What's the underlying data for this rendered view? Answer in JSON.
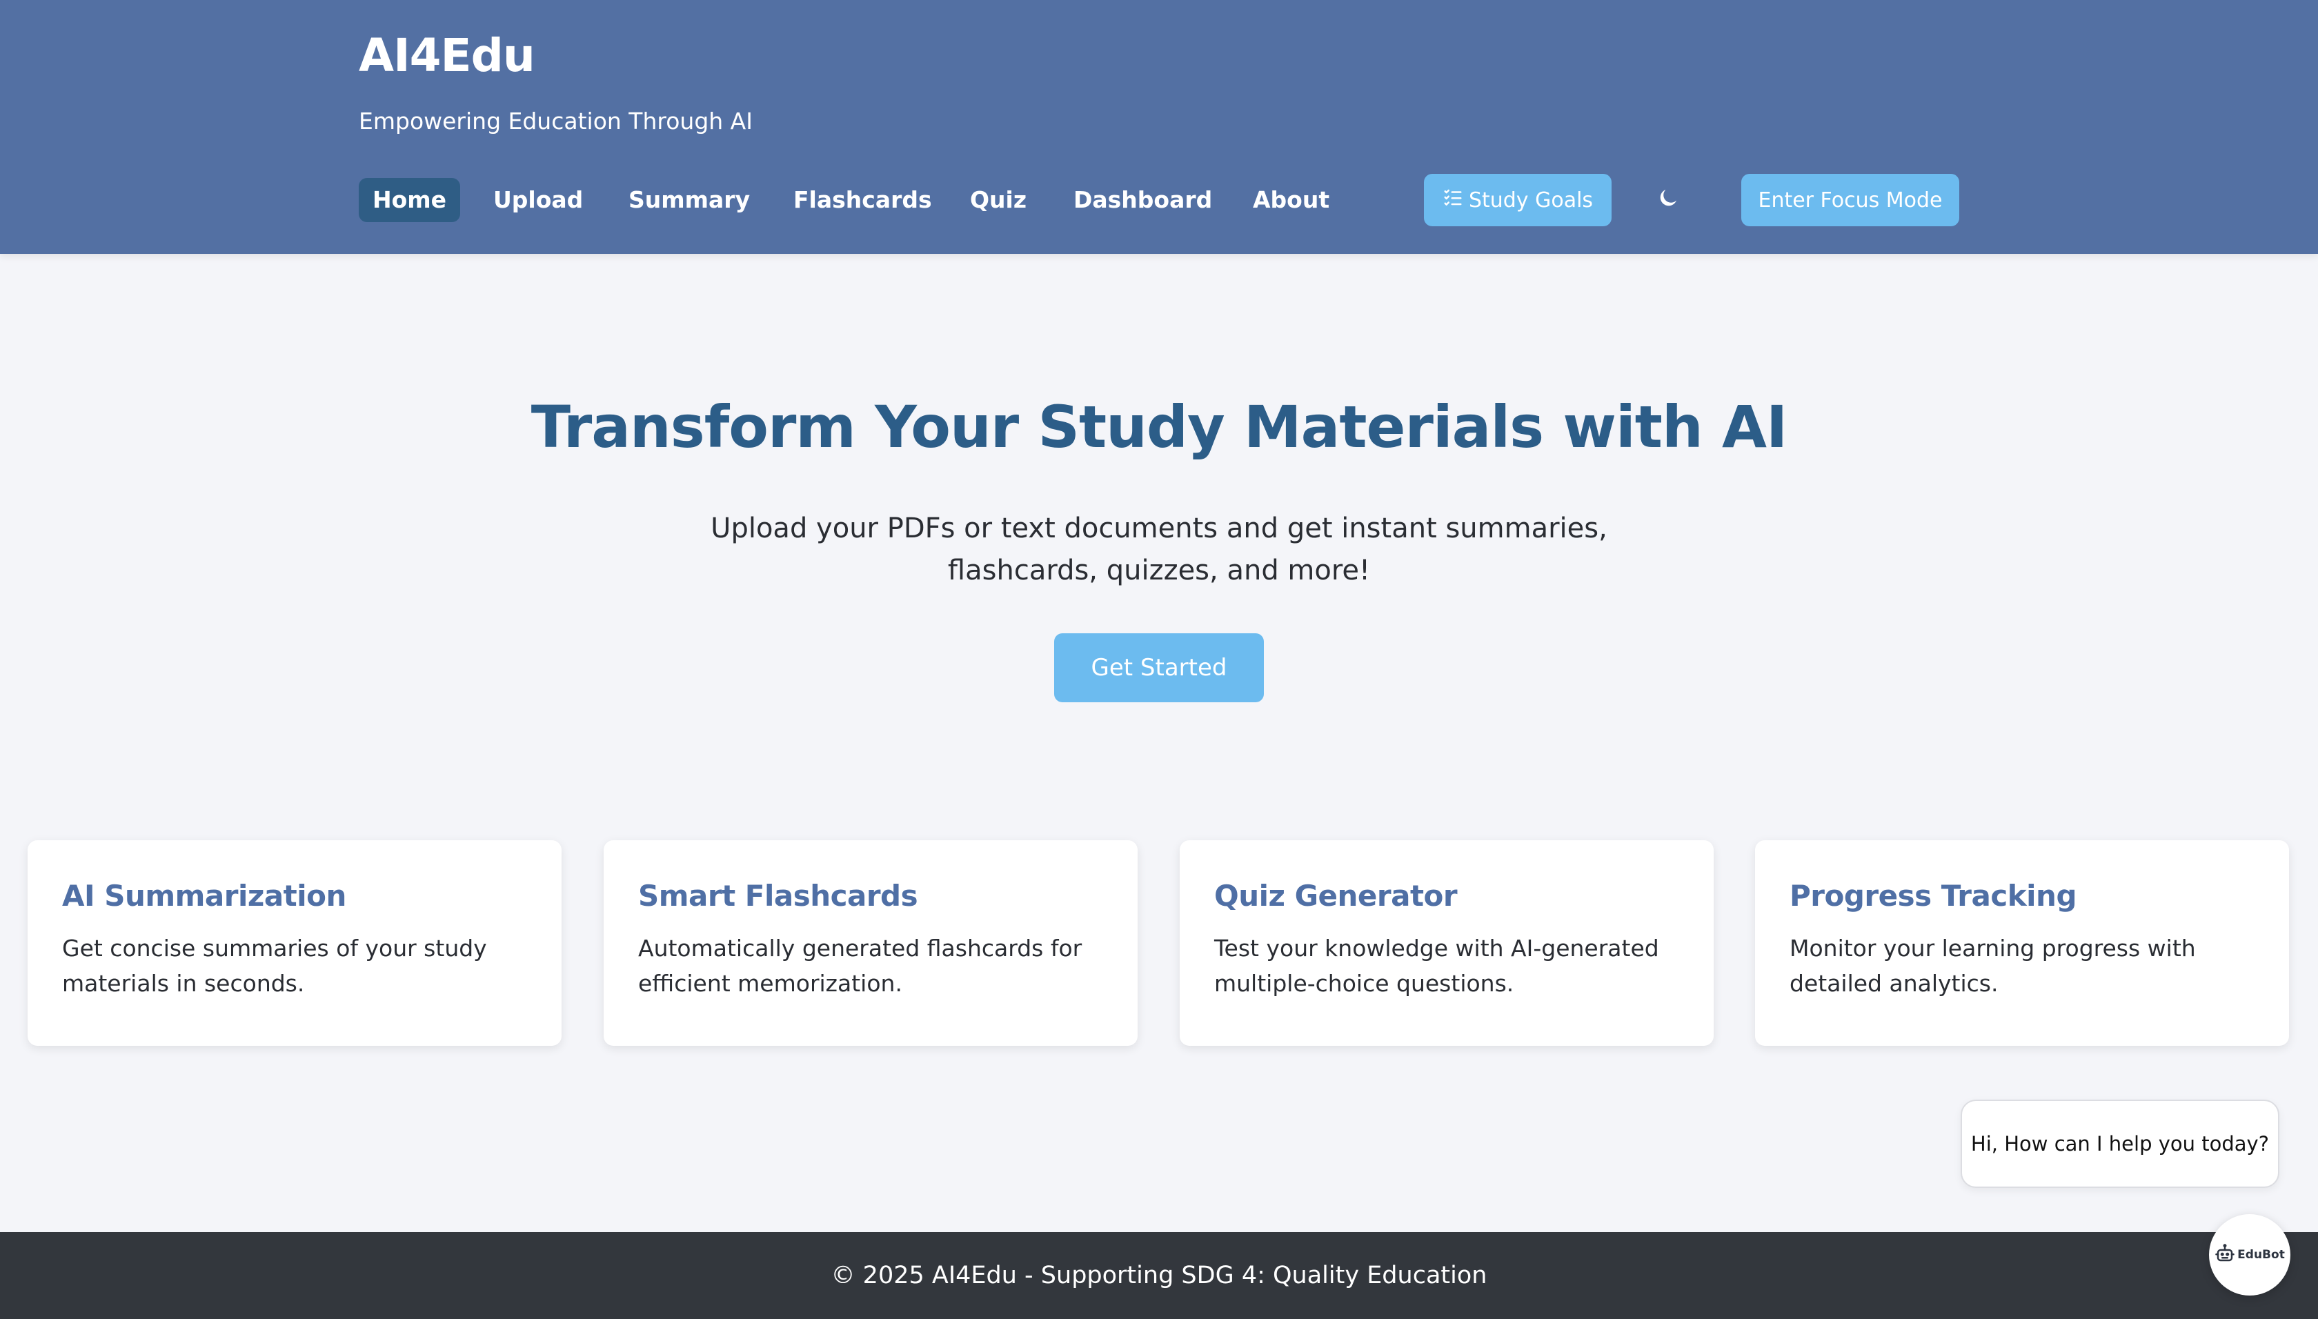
{
  "app": {
    "title": "AI4Edu",
    "tagline": "Empowering Education Through AI"
  },
  "nav": {
    "items": [
      {
        "label": "Home",
        "active": true
      },
      {
        "label": "Upload",
        "active": false
      },
      {
        "label": "Summary",
        "active": false
      },
      {
        "label": "Flashcards",
        "active": false
      },
      {
        "label": "Quiz",
        "active": false
      },
      {
        "label": "Dashboard",
        "active": false
      },
      {
        "label": "About",
        "active": false
      }
    ],
    "study_goals_label": "Study Goals",
    "study_goals_icon": "checklist-icon",
    "theme_toggle_icon": "moon-icon",
    "focus_mode_label": "Enter Focus Mode"
  },
  "hero": {
    "title": "Transform Your Study Materials with AI",
    "subtitle": "Upload your PDFs or text documents and get instant summaries, flashcards, quizzes, and more!",
    "cta_label": "Get Started"
  },
  "features": [
    {
      "title": "AI Summarization",
      "text": "Get concise summaries of your study materials in seconds."
    },
    {
      "title": "Smart Flashcards",
      "text": "Automatically generated flashcards for efficient memorization."
    },
    {
      "title": "Quiz Generator",
      "text": "Test your knowledge with AI-generated multiple-choice questions."
    },
    {
      "title": "Progress Tracking",
      "text": "Monitor your learning progress with detailed analytics."
    }
  ],
  "chat": {
    "greeting": "Hi, How can I help you today?",
    "bot_label": "EduBot",
    "bot_icon": "robot-icon"
  },
  "footer": {
    "text": "© 2025 AI4Edu - Supporting SDG 4: Quality Education"
  },
  "colors": {
    "header_bg": "#5370a3",
    "nav_active_bg": "#2f5d85",
    "accent_button": "#6cbbef",
    "hero_title": "#2c5d88",
    "card_title": "#4f6fa5",
    "footer_bg": "#33373d",
    "page_bg": "#f4f5f9"
  }
}
